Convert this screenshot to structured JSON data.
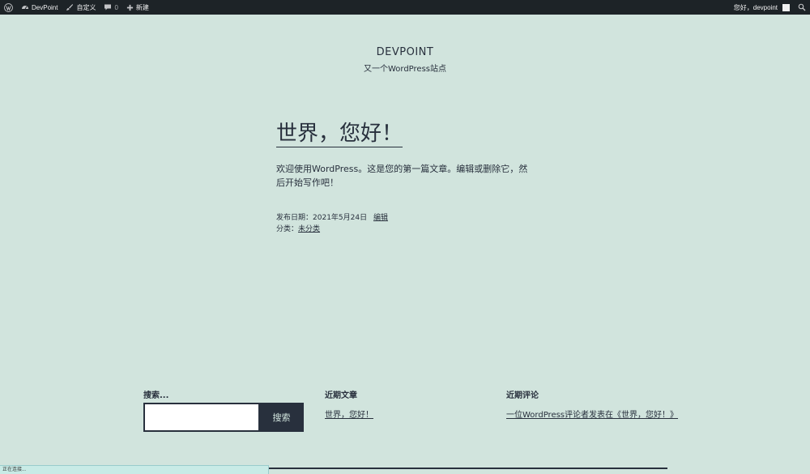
{
  "admin_bar": {
    "site_name": "DevPoint",
    "customize": "自定义",
    "comments_count": "0",
    "new": "新建",
    "greeting": "您好，devpoint"
  },
  "header": {
    "site_title": "DEVPOINT",
    "tagline": "又一个WordPress站点"
  },
  "post": {
    "title": "世界，您好！",
    "body": "欢迎使用WordPress。这是您的第一篇文章。编辑或删除它，然后开始写作吧！",
    "published_label": "发布日期：",
    "published_date": "2021年5月24日",
    "edit_link": "编辑",
    "category_label": "分类：",
    "category": "未分类"
  },
  "footer": {
    "search": {
      "title": "搜索...",
      "button": "搜索",
      "value": ""
    },
    "recent_posts": {
      "title": "近期文章",
      "items": [
        "世界，您好！"
      ]
    },
    "recent_comments": {
      "title": "近期评论",
      "items": [
        "一位WordPress评论者发表在《世界，您好！》"
      ]
    }
  },
  "status_bar": "正在连接..."
}
